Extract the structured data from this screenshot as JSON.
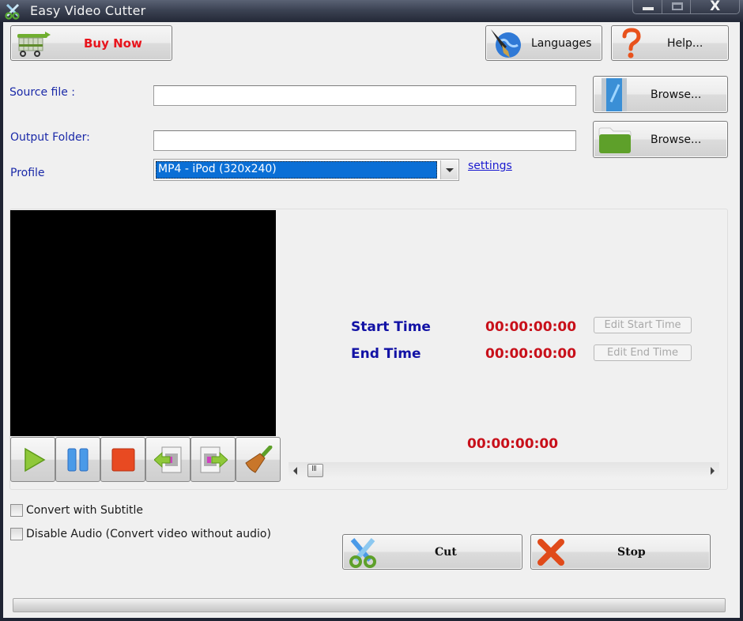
{
  "window": {
    "title": "Easy Video Cutter",
    "controls": {
      "minimize": "minimize",
      "maximize": "maximize",
      "close": "X"
    }
  },
  "toolbar": {
    "buy_now": "Buy Now",
    "languages": "Languages",
    "help": "Help..."
  },
  "form": {
    "source_label": "Source file :",
    "source_value": "",
    "source_browse": "Browse...",
    "output_label": "Output Folder:",
    "output_value": "",
    "output_browse": "Browse...",
    "profile_label": "Profile",
    "profile_selected": "MP4 - iPod (320x240)",
    "settings_link": "settings"
  },
  "player": {
    "controls": [
      {
        "name": "play",
        "icon": "play-icon"
      },
      {
        "name": "pause",
        "icon": "pause-icon"
      },
      {
        "name": "stop",
        "icon": "stop-icon"
      },
      {
        "name": "set-start",
        "icon": "mark-start-icon"
      },
      {
        "name": "set-end",
        "icon": "mark-end-icon"
      },
      {
        "name": "clear",
        "icon": "broom-icon"
      }
    ],
    "start_time_label": "Start Time",
    "start_time_value": "00:00:00:00",
    "edit_start_label": "Edit Start Time",
    "end_time_label": "End Time",
    "end_time_value": "00:00:00:00",
    "edit_end_label": "Edit End Time",
    "current_time": "00:00:00:00",
    "seek_position": 0
  },
  "options": {
    "subtitle_label": "Convert with Subtitle",
    "subtitle_checked": false,
    "disable_audio_label": "Disable Audio (Convert video without audio)",
    "disable_audio_checked": false
  },
  "actions": {
    "cut": "Cut",
    "stop": "Stop"
  },
  "progress": {
    "percent": 0
  },
  "colors": {
    "label_blue": "#1a29a8",
    "time_red": "#c8101a",
    "buy_now_red": "#e8141c",
    "selection_blue": "#0a6fd6"
  }
}
